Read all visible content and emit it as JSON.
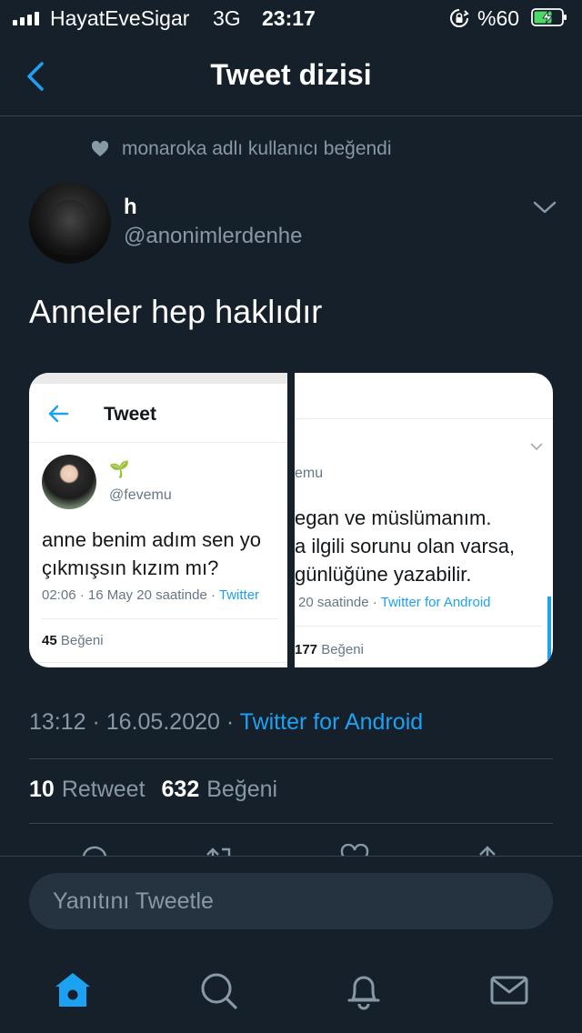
{
  "status_bar": {
    "carrier": "HayatEveSigar",
    "network": "3G",
    "time": "23:17",
    "battery_percent": "%60",
    "signal_bars": 4,
    "battery_level": 0.6,
    "icons": [
      "signal-icon",
      "rotation-lock-icon",
      "battery-charging-icon"
    ]
  },
  "header": {
    "title": "Tweet dizisi",
    "back_icon": "chevron-left-icon"
  },
  "social_context": {
    "text": "monaroka adlı kullanıcı beğendi",
    "icon": "heart-icon"
  },
  "tweet": {
    "author_name": "h",
    "author_handle": "@anonimlerdenhe",
    "text": "Anneler hep haklıdır",
    "timestamp": "13:12 · 16.05.2020 · ",
    "source": "Twitter for Android",
    "retweet_count": "10",
    "retweet_label": "Retweet",
    "like_count": "632",
    "like_label": "Beğeni"
  },
  "media": {
    "left": {
      "title": "Tweet",
      "sprout": "🌱",
      "handle": "@fevemu",
      "text_line1": "anne benim adım sen yo",
      "text_line2": "çıkmışsın kızım mı?",
      "meta": "02:06 · 16 May 20 saatinde · ",
      "meta_app": "Twitter",
      "likes_count": "45",
      "likes_label": " Beğeni"
    },
    "right": {
      "handle": "emu",
      "text_line1": "egan ve müslümanım.",
      "text_line2": "a ilgili sorunu olan varsa,",
      "text_line3": "günlüğüne yazabilir.",
      "meta": "20 saatinde · ",
      "meta_app": "Twitter for Android",
      "likes_count": "177",
      "likes_label": " Beğeni"
    }
  },
  "actions": [
    "reply-icon",
    "retweet-icon",
    "like-icon",
    "share-icon"
  ],
  "reply_bar": {
    "placeholder": "Yanıtını Tweetle"
  },
  "tab_bar": [
    "home-icon",
    "search-icon",
    "notifications-icon",
    "messages-icon"
  ],
  "colors": {
    "background": "#15202b",
    "accent": "#1da1f2",
    "muted_text": "#8899a6",
    "divider": "#38444d"
  }
}
